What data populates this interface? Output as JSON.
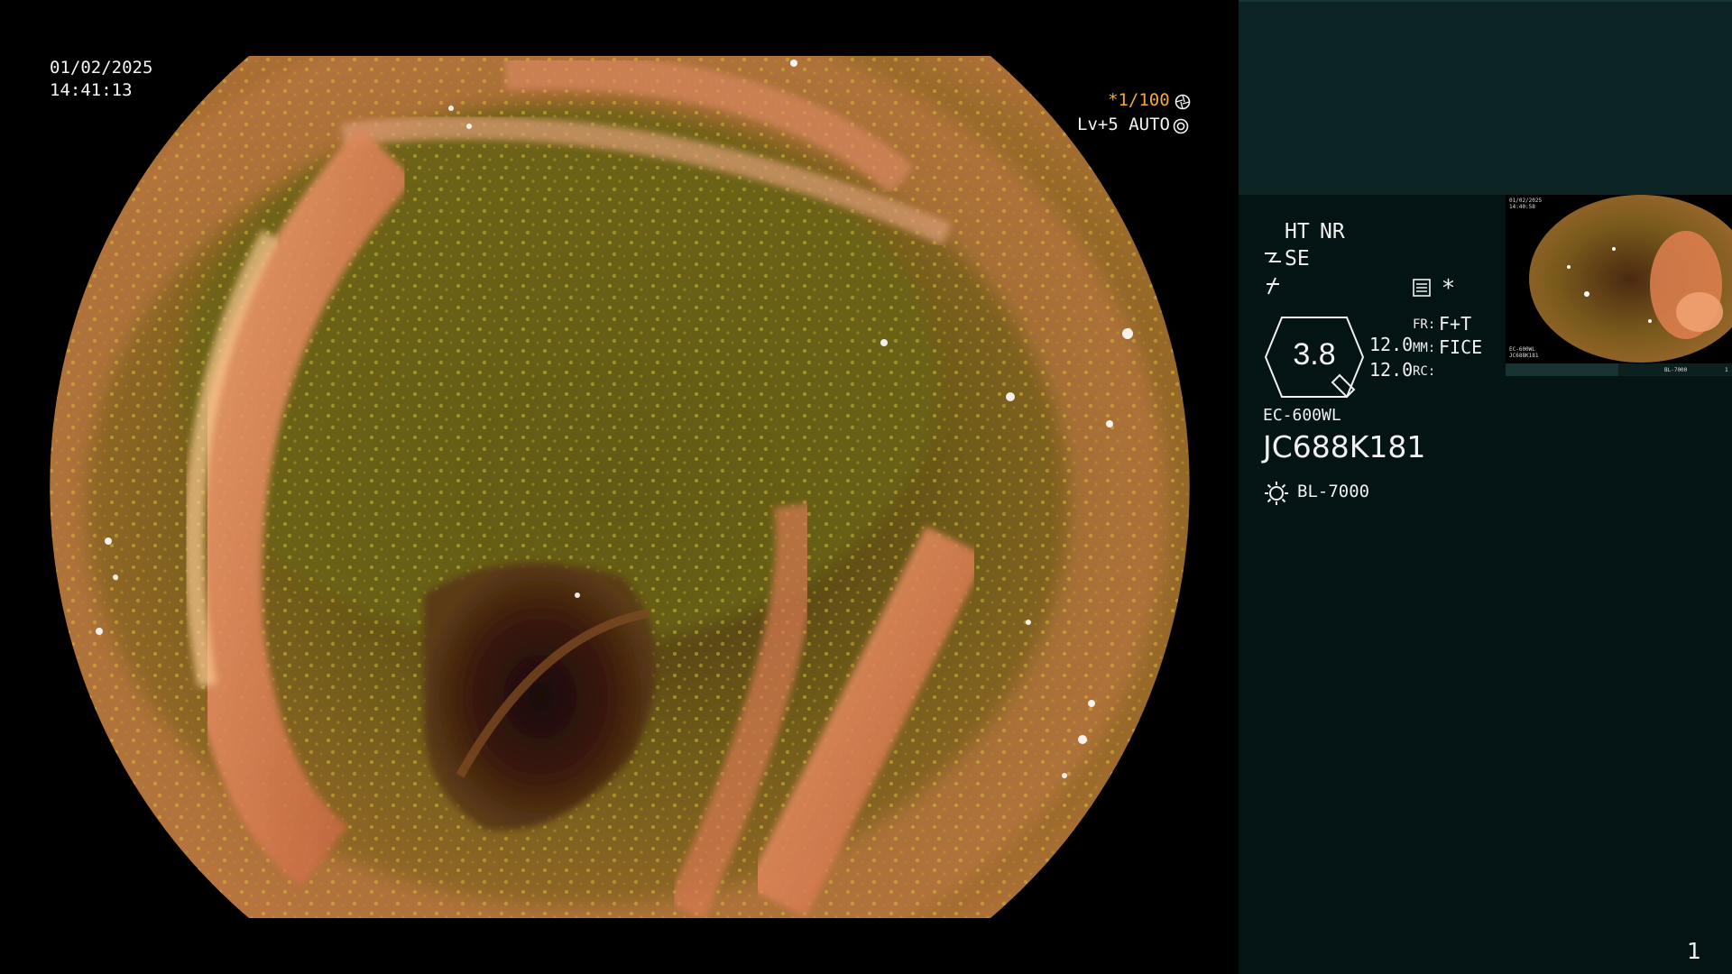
{
  "overlay": {
    "date": "01/02/2025",
    "time": "14:41:13",
    "shutter": "*1/100",
    "shutter_icon": "aperture-icon",
    "iris_level": "Lv+5 AUTO",
    "iris_icon": "iris-auto-icon"
  },
  "panel": {
    "ht_label": "HT",
    "nr_label": "NR",
    "se_label": "SE",
    "se_icon": "structure-enhance-icon",
    "f_icon": "fixed-icon",
    "menu_icon": "settings-menu-icon",
    "asterisk": "*",
    "zoom_value": "3.8",
    "value_top": "12.0",
    "value_bottom": "12.0",
    "fr_label": "FR:",
    "fr_value": "F+T",
    "mm_label": "MM:",
    "mm_value": "FICE",
    "rc_label": "RC:",
    "rc_value": "",
    "scope_model": "EC-600WL",
    "scope_serial": "JC688K181",
    "light_icon": "light-source-icon",
    "light_source": "BL-7000",
    "page_number": "1"
  },
  "thumbnail": {
    "date": "01/02/2025",
    "time": "14:40:58",
    "model": "EC-600WL",
    "serial": "JC688K181",
    "light": "BL-7000",
    "index": "1"
  },
  "colors": {
    "accent_orange": "#f2a93c",
    "panel_bg": "#041414",
    "panel_top_bg": "#0c2424"
  }
}
